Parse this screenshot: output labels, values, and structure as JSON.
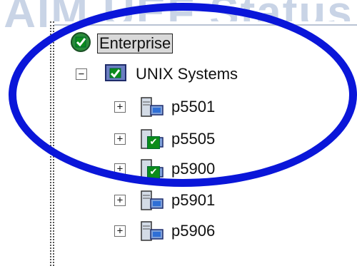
{
  "banner": {
    "text": "AIM UEF Status",
    "color": "#c9d4e6"
  },
  "tree": {
    "root": {
      "label": "Enterprise",
      "icon": "green-check-status-icon"
    },
    "group": {
      "label": "UNIX Systems",
      "expander": "−",
      "icon": "green-check-folder-icon"
    },
    "systems": [
      {
        "label": "p5501",
        "expander": "+",
        "icon": "server-icon",
        "status": "none"
      },
      {
        "label": "p5505",
        "expander": "+",
        "icon": "server-icon",
        "status": "ok"
      },
      {
        "label": "p5900",
        "expander": "+",
        "icon": "server-icon",
        "status": "ok"
      },
      {
        "label": "p5901",
        "expander": "+",
        "icon": "server-icon",
        "status": "none"
      },
      {
        "label": "p5906",
        "expander": "+",
        "icon": "server-icon",
        "status": "none"
      }
    ]
  },
  "annotation": {
    "shape": "ellipse",
    "color": "#0a16d9"
  },
  "colors": {
    "status_ok": "#0b8c1b",
    "annotation": "#0a16d9"
  }
}
